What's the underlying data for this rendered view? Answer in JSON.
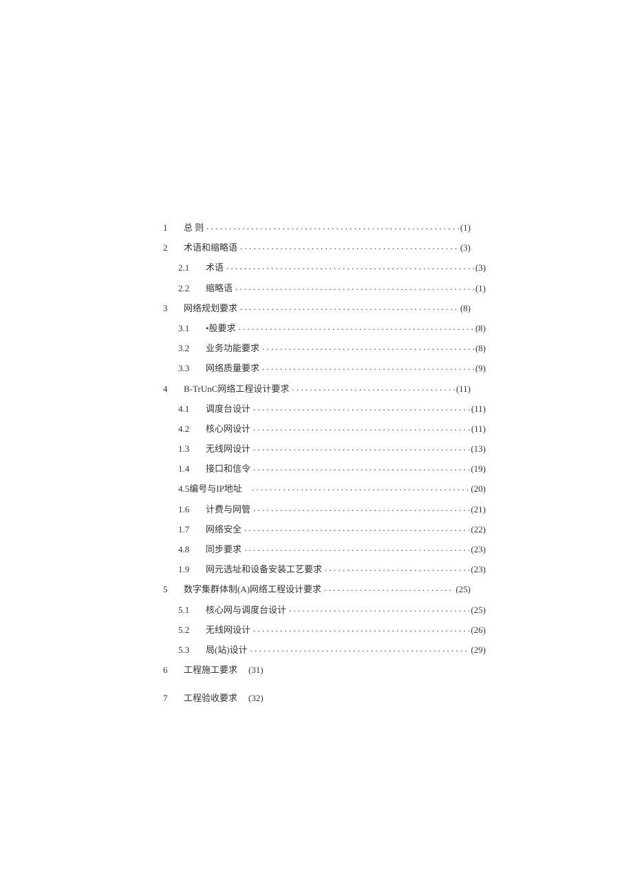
{
  "toc": [
    {
      "num": "1",
      "title": "总  则",
      "page": "(1)",
      "level": 0
    },
    {
      "num": "2",
      "title": "术语和缩略语",
      "page": "(3)",
      "level": 0
    },
    {
      "num": "2.1",
      "title": "术语",
      "page": "(3)",
      "level": 1
    },
    {
      "num": "2.2",
      "title": "缩略语",
      "page": "(1)",
      "level": 1
    },
    {
      "num": "3",
      "title": "网络规划要求",
      "page": "(8)",
      "level": 0
    },
    {
      "num": "3.1",
      "title": "•股要求",
      "page": "(8)",
      "level": 1
    },
    {
      "num": "3.2",
      "title": "业务功能要求",
      "page": "(8)",
      "level": 1
    },
    {
      "num": "3.3",
      "title": "网络质量要求",
      "page": "(9)",
      "level": 1
    },
    {
      "num": "4",
      "title": "B-TrUnC网络工程设计要求",
      "page": "(11)",
      "level": 0
    },
    {
      "num": "4.1",
      "title": "调度台设计",
      "page": "(11)",
      "level": 1
    },
    {
      "num": "4.2",
      "title": "核心网设计",
      "page": "(11)",
      "level": 1
    },
    {
      "num": "1.3",
      "title": "无线网设计",
      "page": "(13)",
      "level": 1
    },
    {
      "num": "1.4",
      "title": "接口和信令",
      "page": "(19)",
      "level": 1
    },
    {
      "num": "4.5编号与IP地址",
      "title": "",
      "page": "(20)",
      "level": 1,
      "merged": true
    },
    {
      "num": "1.6",
      "title": "计费与网管",
      "page": "(21)",
      "level": 1
    },
    {
      "num": "1.7",
      "title": "网络安全",
      "page": "(22)",
      "level": 1
    },
    {
      "num": "4.8",
      "title": "同步要求",
      "page": "(23)",
      "level": 1
    },
    {
      "num": "1.9",
      "title": "网元选址和设备安装工艺要求",
      "page": "(23)",
      "level": 1
    },
    {
      "num": "5",
      "title": "数字集群体制(A)网络工程设计要求 ",
      "page": "(25)",
      "level": 0
    },
    {
      "num": "5.1",
      "title": "核心网与调度台设计",
      "page": "(25)",
      "level": 1
    },
    {
      "num": "5.2",
      "title": "无线网设计",
      "page": "(26)",
      "level": 1
    },
    {
      "num": "5.3",
      "title": "局(站)设计",
      "page": "(29)",
      "level": 1
    },
    {
      "num": "6",
      "title": "工程施工要求",
      "page": "(31)",
      "level": 0,
      "nodots": true
    },
    {
      "num": "7",
      "title": "工程验收要求",
      "page": "(32)",
      "level": 0,
      "nodots": true
    }
  ]
}
